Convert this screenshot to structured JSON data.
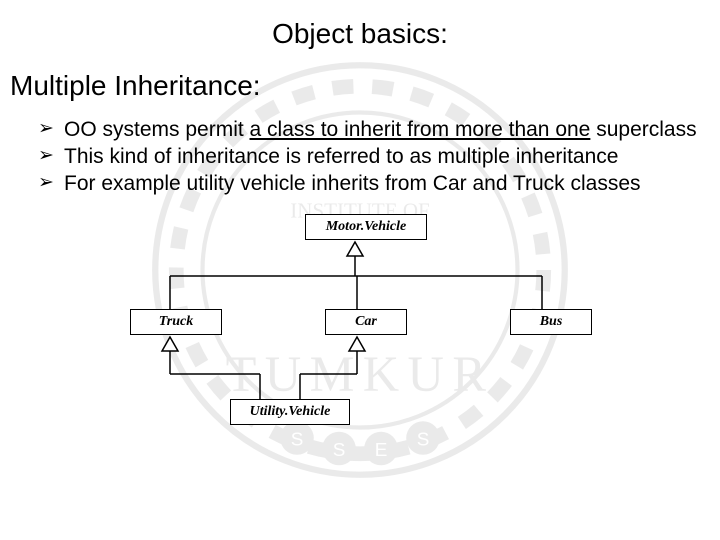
{
  "title": "Object basics:",
  "subtitle": "Multiple Inheritance:",
  "bullets": {
    "b1_pre": "OO systems permit ",
    "b1_u": "a class to inherit from more than one",
    "b1_post": " superclass",
    "b2": "This kind of inheritance is referred to as multiple inheritance",
    "b3": "For example  utility vehicle inherits from Car and Truck classes"
  },
  "diagram": {
    "motor": "Motor.Vehicle",
    "truck": "Truck",
    "car": "Car",
    "bus": "Bus",
    "utility": "Utility.Vehicle"
  }
}
